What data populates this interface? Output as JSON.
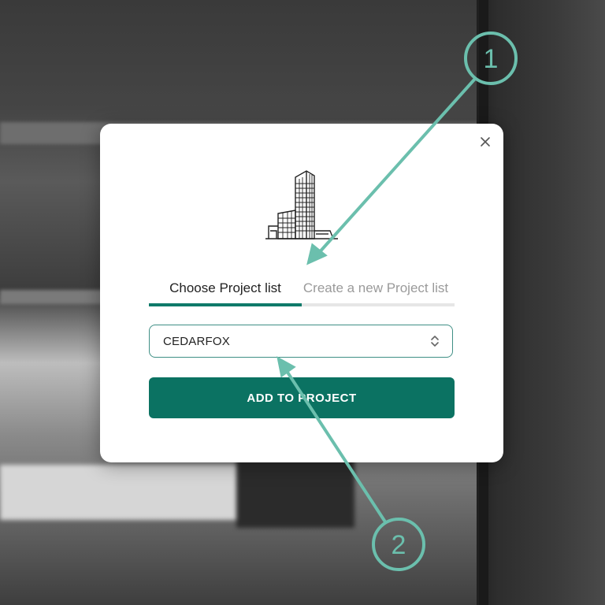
{
  "modal": {
    "close_icon": "close-icon",
    "illustration_icon": "building-icon",
    "tabs": [
      {
        "label": "Choose Project list",
        "active": true
      },
      {
        "label": "Create a new Project list",
        "active": false
      }
    ],
    "select": {
      "value": "CEDARFOX",
      "chevron_icon": "chevron-up-down-icon"
    },
    "add_button_label": "ADD TO PROJECT"
  },
  "annotations": [
    {
      "number": "1"
    },
    {
      "number": "2"
    }
  ],
  "colors": {
    "accent": "#0b7262",
    "annotation": "#6bbfad",
    "inactive_tab": "#9a9a9a"
  }
}
